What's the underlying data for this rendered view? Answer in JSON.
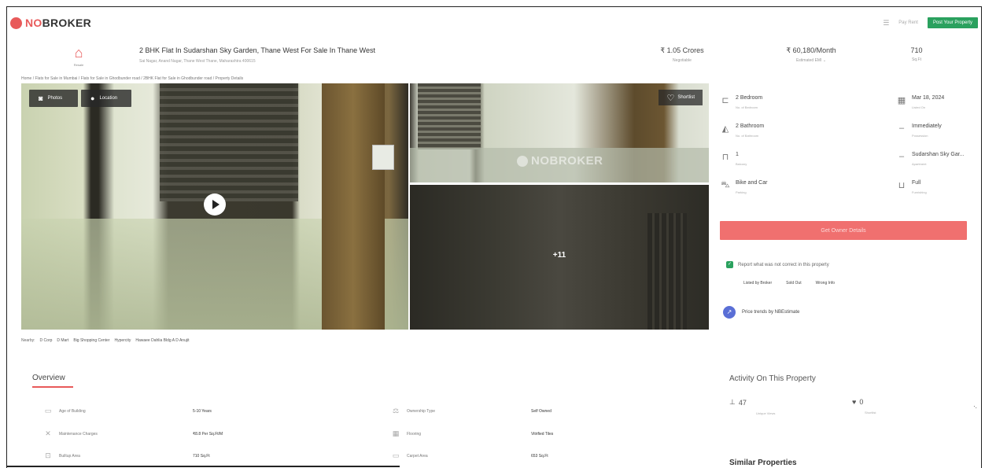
{
  "header": {
    "logo_prefix": "NO",
    "logo_suffix": "BROKER",
    "menu_label": "Pay Rent",
    "post_button": "Post Your Property"
  },
  "property": {
    "icon_caption": "Resale",
    "title": "2 BHK Flat In Sudarshan Sky Garden, Thane West For Sale In Thane West",
    "address": "Sai Nagar, Anand Nagar, Thane West Thane, Maharashtra 400615",
    "price": "₹ 1.05 Crores",
    "price_sub": "Negotiable",
    "emi": "₹ 60,180/Month",
    "emi_sub": "Estimated EMI ⌄",
    "area": "710",
    "area_sub": "Sq.Ft"
  },
  "breadcrumb": "Home / Flats for Sale in Mumbai / Flats for Sale in Ghodbunder road / 2BHK Flat for Sale in Ghodbunder road / Property Details",
  "gallery": {
    "photos_label": "Photos",
    "location_label": "Location",
    "shortlist_label": "Shortlist",
    "watermark": "NOBROKER",
    "more_count": "+11"
  },
  "nearby": {
    "label": "Nearby:",
    "items": [
      "D Corp",
      "D Mart",
      "Big Shopping Center",
      "Hypercity",
      "Hawaee Dahlia Bldg A D Anujit"
    ]
  },
  "details": [
    {
      "icon": "bed-icon",
      "value": "2 Bedroom",
      "label": "No. of Bedroom"
    },
    {
      "icon": "calendar-icon",
      "value": "Mar 18, 2024",
      "label": "Listed On"
    },
    {
      "icon": "bath-icon",
      "value": "2 Bathroom",
      "label": "No. of Bathroom"
    },
    {
      "icon": "key-icon",
      "value": "Immediately",
      "label": "Possession"
    },
    {
      "icon": "balcony-icon",
      "value": "1",
      "label": "Balcony"
    },
    {
      "icon": "building-icon",
      "value": "Sudarshan Sky Gar...",
      "label": "Apartment"
    },
    {
      "icon": "car-icon",
      "value": "Bike and Car",
      "label": "Parking"
    },
    {
      "icon": "sofa-icon",
      "value": "Full",
      "label": "Furnishing"
    }
  ],
  "owner_button": "Get Owner Details",
  "report": {
    "text": "Report what was not correct in this property",
    "links": [
      "Listed by Broker",
      "Sold Out",
      "Wrong Info"
    ]
  },
  "trends_text": "Price trends by NBEstimate",
  "overview": {
    "title": "Overview",
    "rows": [
      {
        "label": "Age of Building",
        "value": "5-10 Years"
      },
      {
        "label": "Ownership Type",
        "value": "Self Owned"
      },
      {
        "label": "Maintenance Charges",
        "value": "₹8.8 Per Sq.Ft/M"
      },
      {
        "label": "Flooring",
        "value": "Vitrified Tiles"
      },
      {
        "label": "Builtup Area",
        "value": "710 Sq.Ft"
      },
      {
        "label": "Carpet Area",
        "value": "653 Sq.Ft"
      }
    ]
  },
  "activity": {
    "title": "Activity On This Property",
    "views": "47",
    "views_label": "Unique Views",
    "shortlists": "0",
    "shortlists_label": "Shortlist"
  },
  "similar_title": "Similar Properties"
}
